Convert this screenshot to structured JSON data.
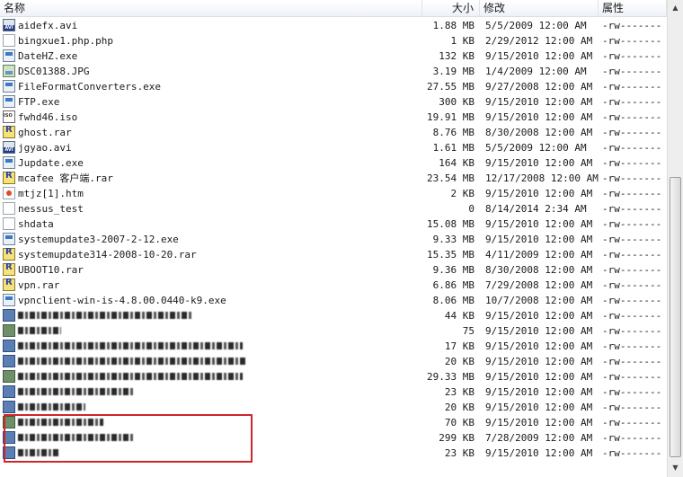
{
  "columns": {
    "name": "名称",
    "size": "大小",
    "modified": "修改",
    "attributes": "属性"
  },
  "files": [
    {
      "name": "aidefx.avi",
      "size": "1.88 MB",
      "modified": "5/5/2009 12:00 AM",
      "attr": "-rw-------",
      "icon": "avi-icon"
    },
    {
      "name": "bingxue1.php.php",
      "size": "1 KB",
      "modified": "2/29/2012 12:00 AM",
      "attr": "-rw-------",
      "icon": "doc-icon"
    },
    {
      "name": "DateHZ.exe",
      "size": "132 KB",
      "modified": "9/15/2010 12:00 AM",
      "attr": "-rw-------",
      "icon": "exe-icon"
    },
    {
      "name": "DSC01388.JPG",
      "size": "3.19 MB",
      "modified": "1/4/2009 12:00 AM",
      "attr": "-rw-------",
      "icon": "image-icon"
    },
    {
      "name": "FileFormatConverters.exe",
      "size": "27.55 MB",
      "modified": "9/27/2008 12:00 AM",
      "attr": "-rw-------",
      "icon": "exe-icon"
    },
    {
      "name": "FTP.exe",
      "size": "300 KB",
      "modified": "9/15/2010 12:00 AM",
      "attr": "-rw-------",
      "icon": "exe-icon"
    },
    {
      "name": "fwhd46.iso",
      "size": "19.91 MB",
      "modified": "9/15/2010 12:00 AM",
      "attr": "-rw-------",
      "icon": "iso-icon"
    },
    {
      "name": "ghost.rar",
      "size": "8.76 MB",
      "modified": "8/30/2008 12:00 AM",
      "attr": "-rw-------",
      "icon": "rar-icon"
    },
    {
      "name": "jgyao.avi",
      "size": "1.61 MB",
      "modified": "5/5/2009 12:00 AM",
      "attr": "-rw-------",
      "icon": "avi-icon"
    },
    {
      "name": "Jupdate.exe",
      "size": "164 KB",
      "modified": "9/15/2010 12:00 AM",
      "attr": "-rw-------",
      "icon": "exe-icon"
    },
    {
      "name": "mcafee 客户端.rar",
      "size": "23.54 MB",
      "modified": "12/17/2008 12:00 AM",
      "attr": "-rw-------",
      "icon": "rar-icon"
    },
    {
      "name": "mtjz[1].htm",
      "size": "2 KB",
      "modified": "9/15/2010 12:00 AM",
      "attr": "-rw-------",
      "icon": "html-icon"
    },
    {
      "name": "nessus_test",
      "size": "0",
      "modified": "8/14/2014 2:34 AM",
      "attr": "-rw-------",
      "icon": "doc-icon"
    },
    {
      "name": "shdata",
      "size": "15.08 MB",
      "modified": "9/15/2010 12:00 AM",
      "attr": "-rw-------",
      "icon": "doc-icon"
    },
    {
      "name": "systemupdate3-2007-2-12.exe",
      "size": "9.33 MB",
      "modified": "9/15/2010 12:00 AM",
      "attr": "-rw-------",
      "icon": "exe-icon"
    },
    {
      "name": "systemupdate314-2008-10-20.rar",
      "size": "15.35 MB",
      "modified": "4/11/2009 12:00 AM",
      "attr": "-rw-------",
      "icon": "rar-icon"
    },
    {
      "name": "UBOOT10.rar",
      "size": "9.36 MB",
      "modified": "8/30/2008 12:00 AM",
      "attr": "-rw-------",
      "icon": "rar-icon"
    },
    {
      "name": "vpn.rar",
      "size": "6.86 MB",
      "modified": "7/29/2008 12:00 AM",
      "attr": "-rw-------",
      "icon": "rar-icon"
    },
    {
      "name": "vpnclient-win-is-4.8.00.0440-k9.exe",
      "size": "8.06 MB",
      "modified": "10/7/2008 12:00 AM",
      "attr": "-rw-------",
      "icon": "exe-icon"
    }
  ],
  "obscured_files": [
    {
      "size": "44 KB",
      "modified": "9/15/2010 12:00 AM",
      "attr": "-rw-------",
      "icon": "html-icon",
      "w": 195
    },
    {
      "size": "75",
      "modified": "9/15/2010 12:00 AM",
      "attr": "-rw-------",
      "icon": "doc-icon",
      "w": 48
    },
    {
      "size": "17 KB",
      "modified": "9/15/2010 12:00 AM",
      "attr": "-rw-------",
      "icon": "exe-icon",
      "w": 250
    },
    {
      "size": "20 KB",
      "modified": "9/15/2010 12:00 AM",
      "attr": "-rw-------",
      "icon": "exe-icon",
      "w": 255
    },
    {
      "size": "29.33 MB",
      "modified": "9/15/2010 12:00 AM",
      "attr": "-rw-------",
      "icon": "exe-icon",
      "w": 250
    },
    {
      "size": "23 KB",
      "modified": "9/15/2010 12:00 AM",
      "attr": "-rw-------",
      "icon": "exe-icon",
      "w": 130
    },
    {
      "size": "20 KB",
      "modified": "9/15/2010 12:00 AM",
      "attr": "-rw-------",
      "icon": "exe-icon",
      "w": 75
    },
    {
      "size": "70 KB",
      "modified": "9/15/2010 12:00 AM",
      "attr": "-rw-------",
      "icon": "exe-icon",
      "w": 95
    },
    {
      "size": "299 KB",
      "modified": "7/28/2009 12:00 AM",
      "attr": "-rw-------",
      "icon": "exe-icon",
      "w": 130
    },
    {
      "size": "23 KB",
      "modified": "9/15/2010 12:00 AM",
      "attr": "-rw-------",
      "icon": "exe-icon",
      "w": 45
    }
  ]
}
